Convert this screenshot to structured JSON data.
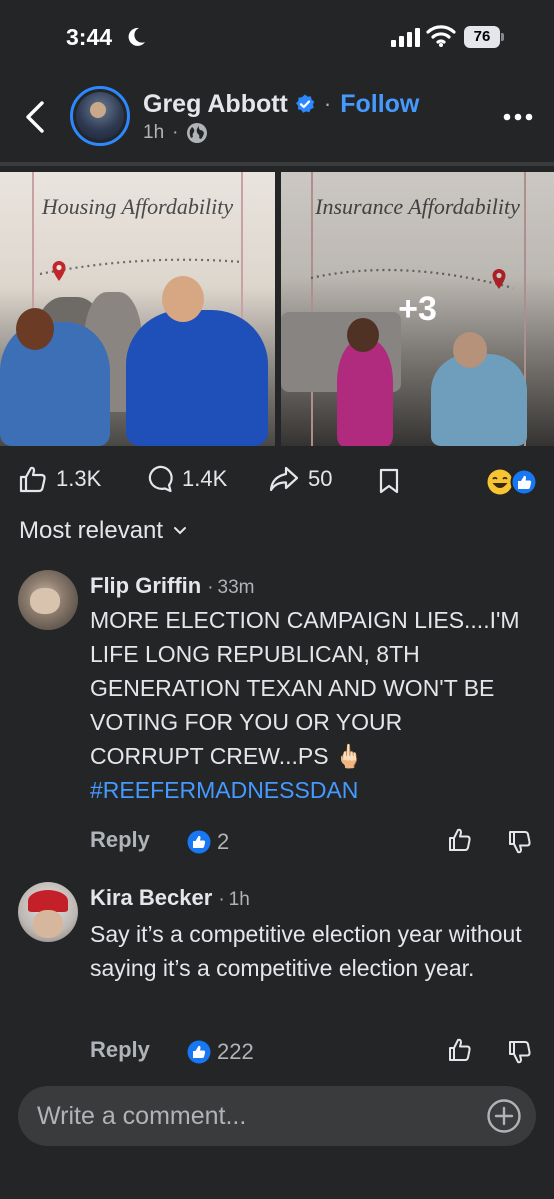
{
  "status": {
    "time": "3:44",
    "battery": "76"
  },
  "header": {
    "author": "Greg Abbott",
    "follow": "Follow",
    "time": "1h",
    "separator": "·"
  },
  "photos": [
    {
      "caption": "Housing Affordability"
    },
    {
      "caption": "Insurance Affordability",
      "more": "+3"
    }
  ],
  "reactions": {
    "likes": "1.3K",
    "comments": "1.4K",
    "shares": "50"
  },
  "sort": {
    "label": "Most relevant"
  },
  "comments": [
    {
      "name": "Flip Griffin",
      "time": "33m",
      "text": "MORE ELECTION CAMPAIGN LIES....I'M LIFE LONG REPUBLICAN, 8TH GENERATION TEXAN AND WON'T BE VOTING FOR YOU OR YOUR CORRUPT CREW...PS 🖕🏻",
      "tag": "#REEFERMADNESSDAN",
      "reply": "Reply",
      "likes": "2"
    },
    {
      "name": "Kira Becker",
      "time": "1h",
      "text": "Say it’s a competitive election year without saying it’s a competitive election year.",
      "reply": "Reply",
      "likes": "222"
    }
  ],
  "composer": {
    "placeholder": "Write a comment..."
  },
  "colors": {
    "accent": "#4599ff",
    "background": "#242526",
    "surface": "#3a3b3c",
    "muted": "#b0b3b8"
  }
}
